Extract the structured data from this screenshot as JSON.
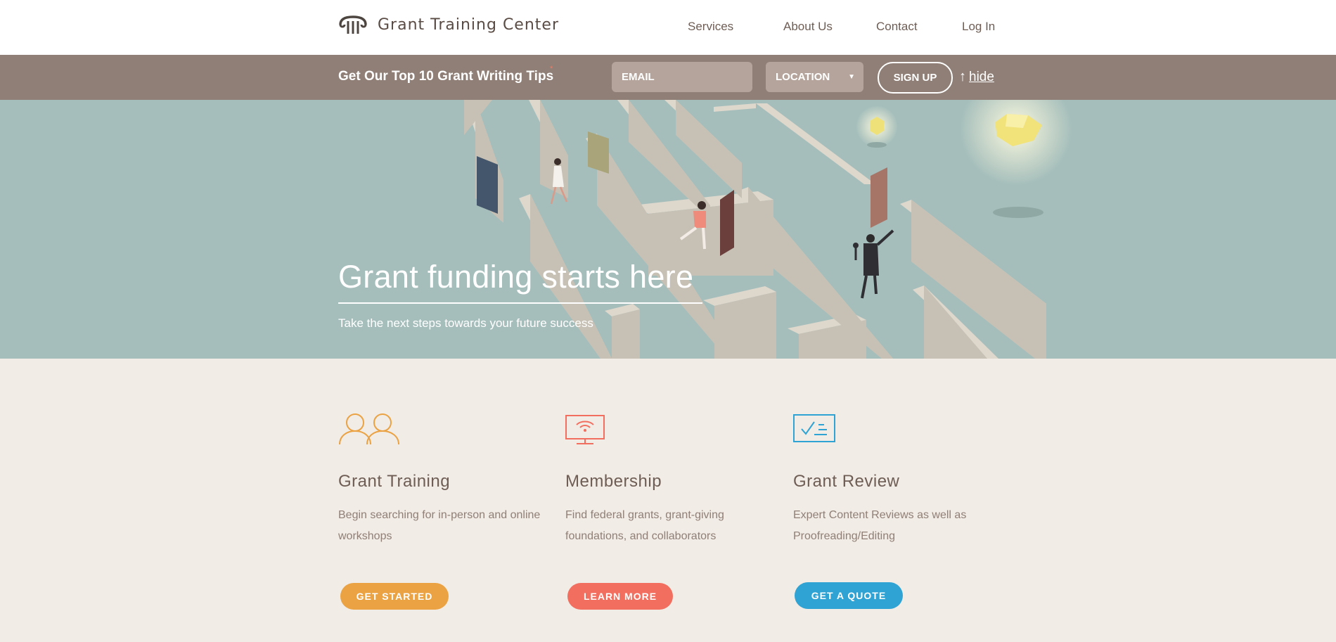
{
  "header": {
    "brand": "Grant Training Center",
    "nav": [
      {
        "label": "Services"
      },
      {
        "label": "About Us"
      },
      {
        "label": "Contact"
      },
      {
        "label": "Log In"
      }
    ]
  },
  "signup": {
    "headline": "Get Our Top 10 Grant Writing Tips",
    "star": "*",
    "email_placeholder": "EMAIL",
    "location_selected": "LOCATION",
    "button": "SIGN UP",
    "hide_arrow": "↑",
    "hide_label": "hide"
  },
  "hero": {
    "title": "Grant funding starts here",
    "subtitle": "Take the next steps towards your future success"
  },
  "cards": [
    {
      "title": "Grant Training",
      "desc": "Begin searching for in-person and online workshops",
      "button": "GET STARTED",
      "color": "#eaa243",
      "icon": "people-icon"
    },
    {
      "title": "Membership",
      "desc": "Find federal grants, grant-giving foundations, and collaborators",
      "button": "LEARN MORE",
      "color": "#f26e5f",
      "icon": "monitor-wifi-icon"
    },
    {
      "title": "Grant Review",
      "desc": "Expert Content Reviews as well as Proofreading/Editing",
      "button": "GET A QUOTE",
      "color": "#2ea3d4",
      "icon": "checklist-icon"
    }
  ]
}
